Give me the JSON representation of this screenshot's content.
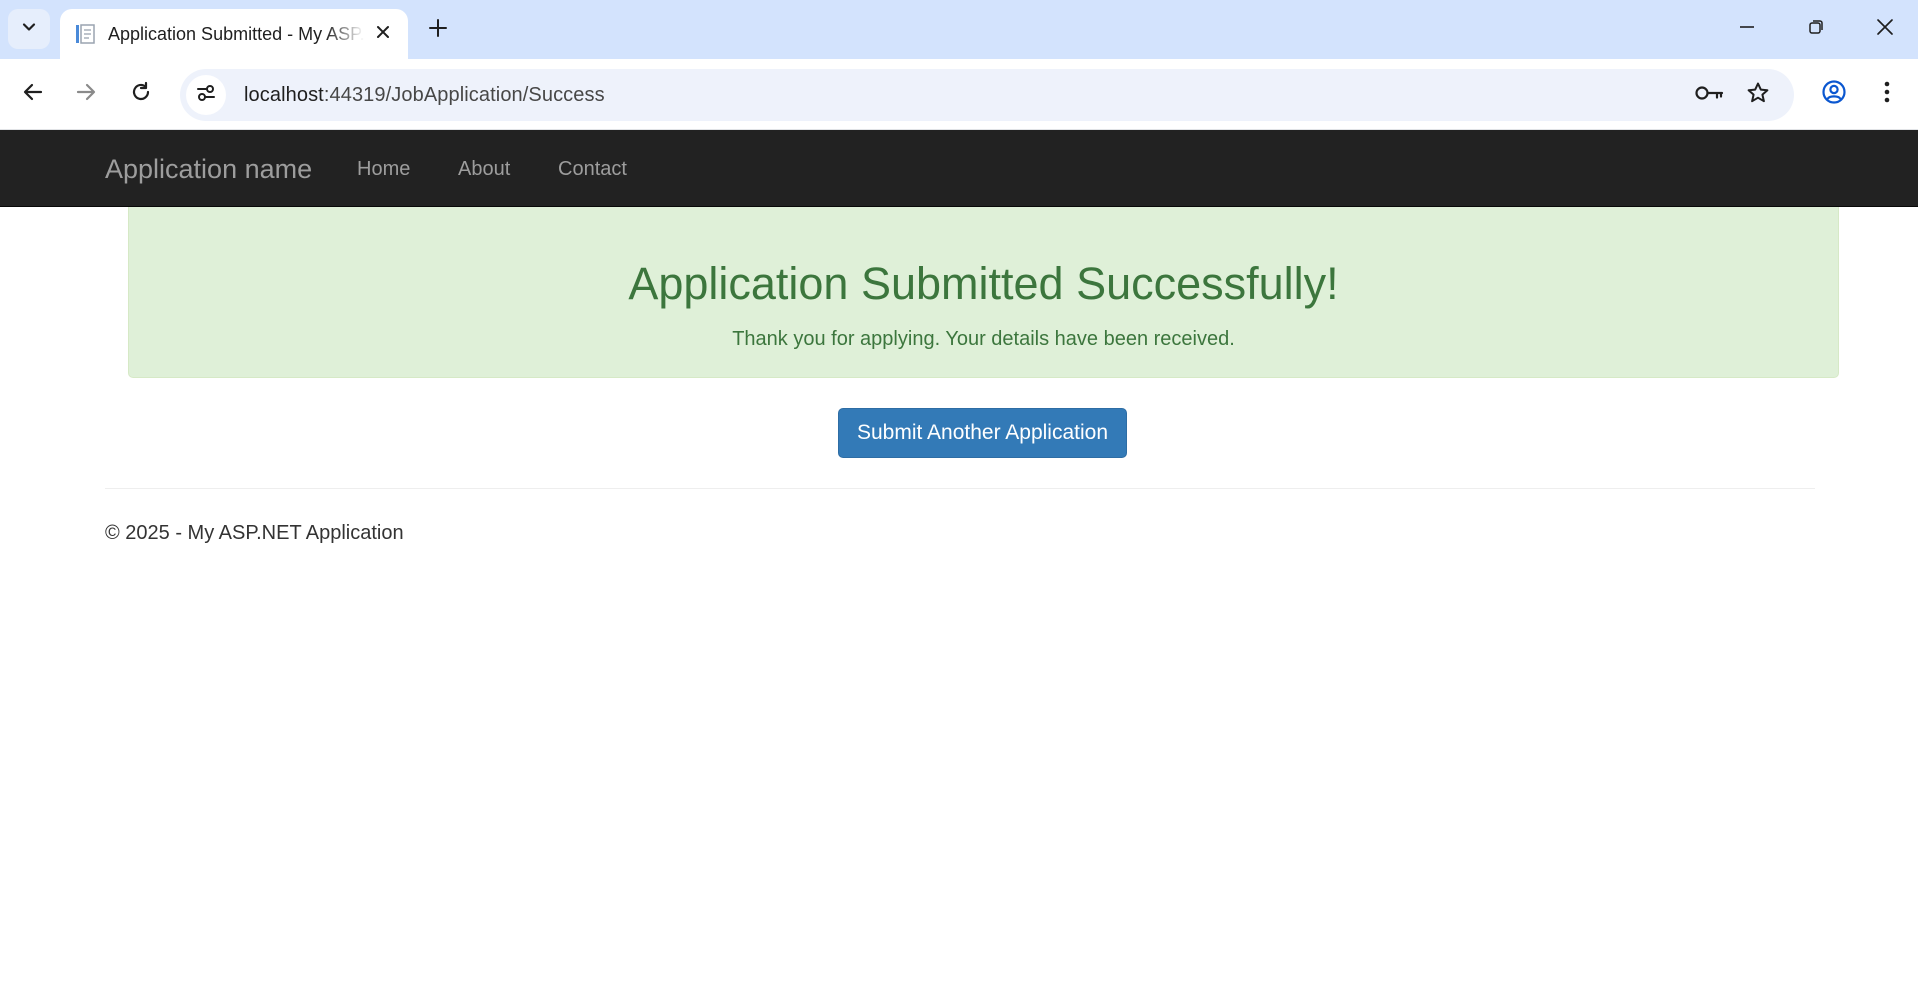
{
  "browser": {
    "tab_title": "Application Submitted - My ASP.NET Application",
    "url_host": "localhost",
    "url_rest": ":44319/JobApplication/Success"
  },
  "navbar": {
    "brand": "Application name",
    "links": [
      "Home",
      "About",
      "Contact"
    ]
  },
  "alert": {
    "heading": "Application Submitted Successfully!",
    "message": "Thank you for applying. Your details have been received."
  },
  "actions": {
    "submit_another_label": "Submit Another Application"
  },
  "footer": {
    "text": "© 2025 - My ASP.NET Application"
  },
  "colors": {
    "chrome_tabstrip": "#d3e3fd",
    "navbar_bg": "#222222",
    "alert_bg": "#dff0d8",
    "alert_text": "#3c763d",
    "primary_button": "#337ab7"
  },
  "icons": [
    "tab-search-icon",
    "page-favicon-icon",
    "close-icon",
    "plus-icon",
    "minimize-icon",
    "restore-icon",
    "window-close-icon",
    "back-arrow-icon",
    "forward-arrow-icon",
    "reload-icon",
    "site-info-icon",
    "key-icon",
    "star-icon",
    "profile-icon",
    "kebab-menu-icon"
  ]
}
